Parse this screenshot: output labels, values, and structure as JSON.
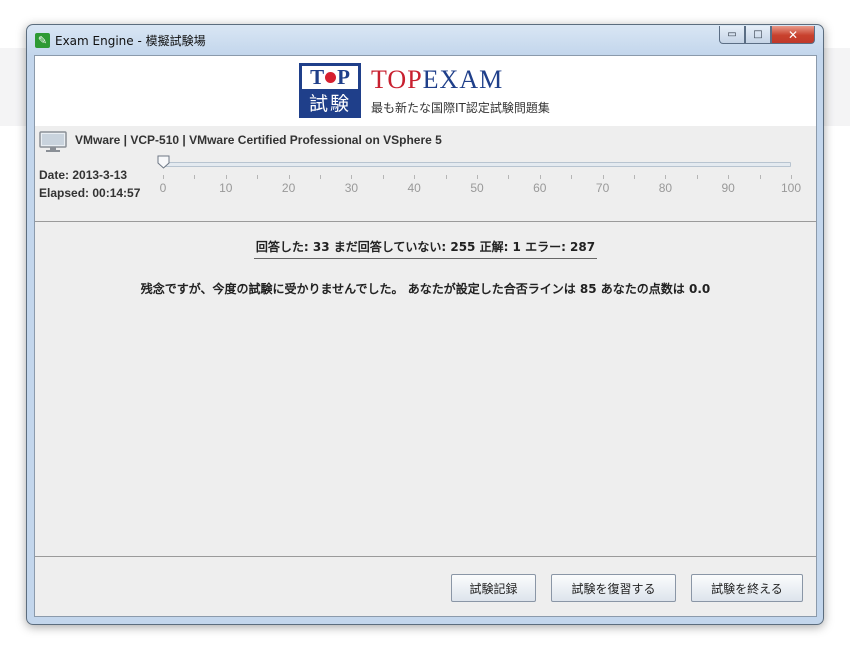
{
  "window": {
    "title": "Exam Engine  - 模擬試験場",
    "controls": {
      "minimize": "▭",
      "maximize": "□",
      "close": "✕"
    }
  },
  "banner": {
    "logo_top": [
      "T",
      "P"
    ],
    "logo_bottom": "試験",
    "brand_first": "TOP",
    "brand_rest": "EXAM",
    "tagline": "最も新たな国際IT認定試験問題集",
    "colors": {
      "navy": "#1f3f8a",
      "red": "#c8202f"
    }
  },
  "exam": {
    "name": "VMware | VCP-510 | VMware Certified Professional on VSphere 5",
    "date": "Date: 2013-3-13",
    "elapsed": "Elapsed: 00:14:57"
  },
  "slider": {
    "value": 0,
    "min": 0,
    "max": 100,
    "labels": [
      "0",
      "10",
      "20",
      "30",
      "40",
      "50",
      "60",
      "70",
      "80",
      "90",
      "100"
    ]
  },
  "results": {
    "stats": "回答した: 33 まだ回答していない: 255 正解: 1 エラー: 287",
    "message": "残念ですが、今度の試験に受かりませんでした。 あなたが設定した合否ラインは 85 あなたの点数は 0.0"
  },
  "buttons": {
    "record": "試験記録",
    "review": "試験を復習する",
    "finish": "試験を終える"
  }
}
